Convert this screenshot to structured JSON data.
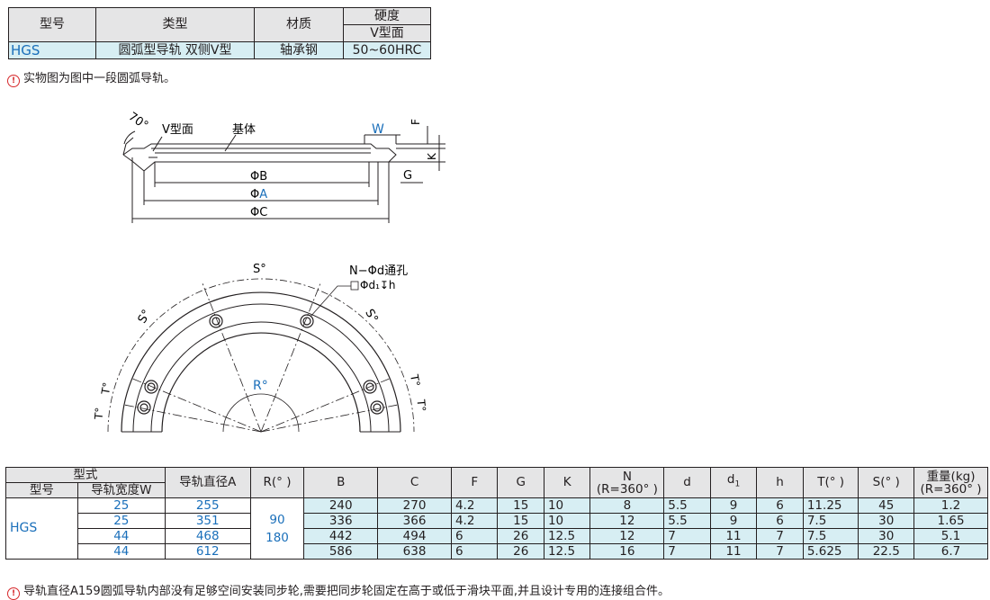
{
  "top_table": {
    "headers": {
      "model": "型号",
      "type": "类型",
      "material": "材质",
      "hardness": "硬度",
      "hardness_sub": "V型面"
    },
    "row": {
      "model": "HGS",
      "type": "圆弧型导轨 双侧V型",
      "material": "轴承钢",
      "hardness": "50~60HRC"
    }
  },
  "note1": "实物图为图中一段圆弧导轨。",
  "diagram_side": {
    "angle": "70°",
    "v_face": "V型面",
    "base": "基体",
    "W": "W",
    "F": "F",
    "K": "K",
    "G": "G",
    "phiB": "ΦB",
    "phiA_prefix": "Φ",
    "phiA": "A",
    "phiC": "ΦC"
  },
  "diagram_top": {
    "S1": "S°",
    "S2": "S°",
    "S3": "S°",
    "T1": "T°",
    "T2": "T°",
    "T3": "T°",
    "T4": "T°",
    "R": "R°",
    "hole1": "N−Φd通孔",
    "hole2": "Φd₁↧h"
  },
  "spec_table": {
    "headers": {
      "model_type": "型式",
      "model": "型号",
      "width": "导轨宽度W",
      "diameter": "导轨直径A",
      "R": "R(° )",
      "B": "B",
      "C": "C",
      "F": "F",
      "G": "G",
      "K": "K",
      "N": "N",
      "N_sub": "(R=360° )",
      "d": "d",
      "d1": "d",
      "d1_sub": "1",
      "h": "h",
      "T": "T(° )",
      "S": "S(° )",
      "weight": "重量(kg)",
      "weight_sub": "(R=360° )"
    },
    "model": "HGS",
    "R_values": [
      "90",
      "180"
    ],
    "rows": [
      {
        "W": "25",
        "A": "255",
        "B": "240",
        "C": "270",
        "F": "4.2",
        "G": "15",
        "K": "10",
        "N": "8",
        "d": "5.5",
        "d1": "9",
        "h": "6",
        "T": "11.25",
        "S": "45",
        "weight": "1.2"
      },
      {
        "W": "25",
        "A": "351",
        "B": "336",
        "C": "366",
        "F": "4.2",
        "G": "15",
        "K": "10",
        "N": "12",
        "d": "5.5",
        "d1": "9",
        "h": "6",
        "T": "7.5",
        "S": "30",
        "weight": "1.65"
      },
      {
        "W": "44",
        "A": "468",
        "B": "442",
        "C": "494",
        "F": "6",
        "G": "26",
        "K": "12.5",
        "N": "12",
        "d": "7",
        "d1": "11",
        "h": "7",
        "T": "7.5",
        "S": "30",
        "weight": "5.1"
      },
      {
        "W": "44",
        "A": "612",
        "B": "586",
        "C": "638",
        "F": "6",
        "G": "26",
        "K": "12.5",
        "N": "16",
        "d": "7",
        "d1": "11",
        "h": "7",
        "T": "5.625",
        "S": "22.5",
        "weight": "6.7"
      }
    ]
  },
  "note2": "导轨直径A159圆弧导轨内部没有足够空间安装同步轮,需要把同步轮固定在高于或低于滑块平面,并且设计专用的连接组合件。",
  "colors": {
    "header_bg": "#e5e5e6",
    "row_bg": "#d7eef3",
    "accent_blue": "#1a6fba",
    "warning_red": "#d6282b"
  }
}
